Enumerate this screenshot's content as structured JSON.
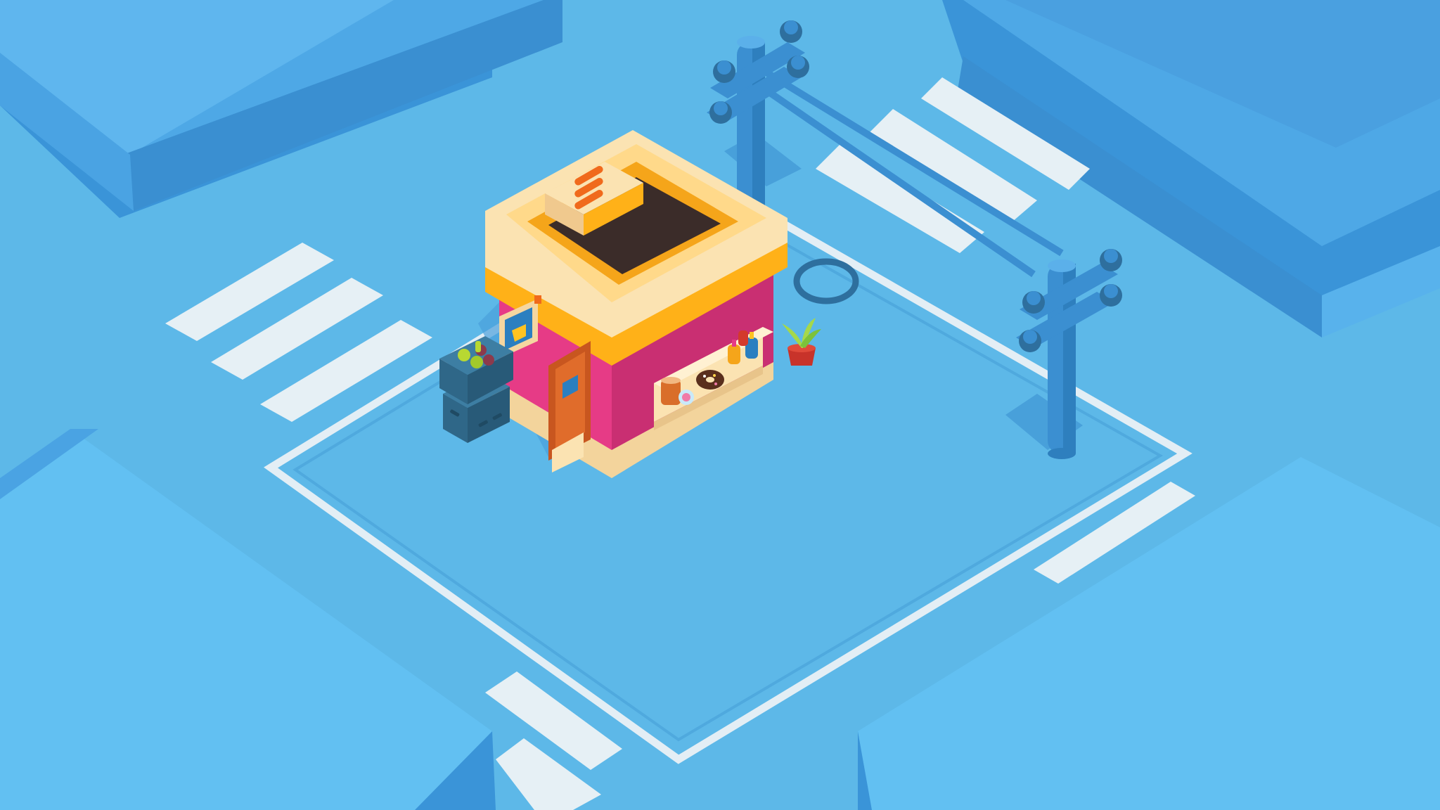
{
  "scene": {
    "kind": "isometric-city-intersection",
    "palette": {
      "ground": "#5db8e8",
      "road": "#5db8e8",
      "block_top": "#62c0f2",
      "block_side": "#3f97d8",
      "block_side_dark": "#3589cc",
      "crosswalk": "#e6f0f5",
      "sidewalk_line": "#e3eef5",
      "pole": "#3b8fd1",
      "pole_dark": "#2e6f9e",
      "shop_wall": "#e63b86",
      "shop_trim": "#ffc321",
      "shop_cream": "#fbe3b2",
      "shop_roof": "#3b2c29",
      "door": "#c8561f",
      "crate": "#2f6788"
    },
    "objects": {
      "buildings": [
        "city-block-top-left",
        "city-block-top-right",
        "city-block-bottom-left",
        "city-block-bottom-right"
      ],
      "shop": "coffee-donut-shop",
      "props": [
        "utility-pole-left",
        "utility-pole-right",
        "power-line",
        "crates-stack",
        "potted-plant",
        "manhole-cover"
      ]
    }
  }
}
